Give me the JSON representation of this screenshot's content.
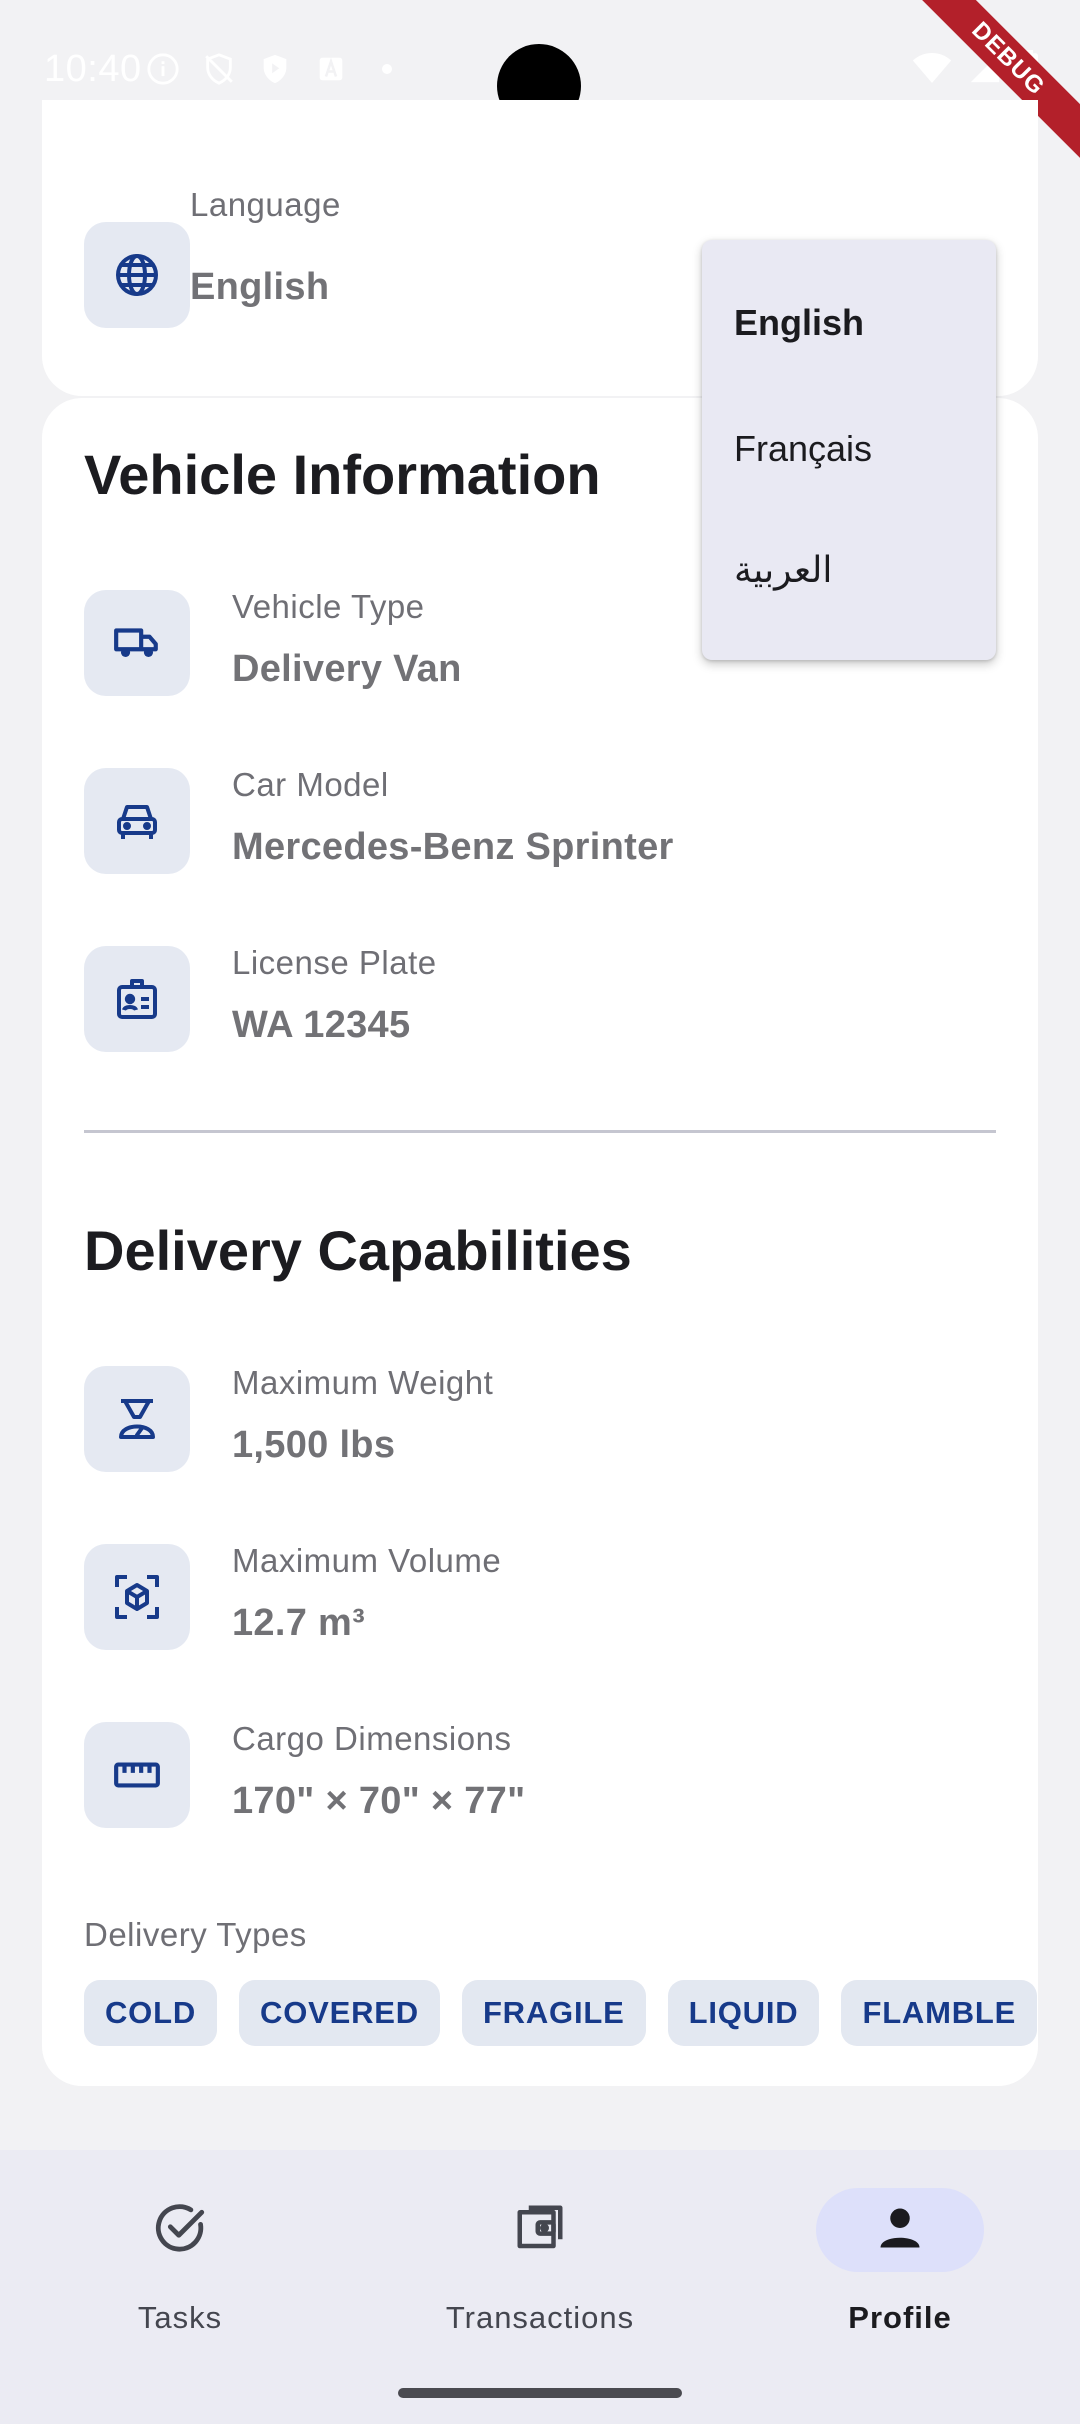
{
  "status_bar": {
    "time": "10:40",
    "debug_label": "DEBUG"
  },
  "language_card": {
    "label": "Language",
    "value": "English",
    "icon": "globe-icon"
  },
  "language_dropdown": {
    "options": [
      "English",
      "Français",
      "العربية"
    ],
    "selected": "English"
  },
  "vehicle_section": {
    "title": "Vehicle Information",
    "rows": [
      {
        "label": "Vehicle Type",
        "value": "Delivery Van",
        "icon": "truck-icon"
      },
      {
        "label": "Car Model",
        "value": "Mercedes-Benz Sprinter",
        "icon": "car-icon"
      },
      {
        "label": "License Plate",
        "value": "WA 12345",
        "icon": "id-card-icon"
      }
    ]
  },
  "capabilities_section": {
    "title": "Delivery Capabilities",
    "rows": [
      {
        "label": "Maximum Weight",
        "value": "1,500 lbs",
        "icon": "scale-icon"
      },
      {
        "label": "Maximum Volume",
        "value": "12.7 m³",
        "icon": "cube-scan-icon"
      },
      {
        "label": "Cargo Dimensions",
        "value": "170\" × 70\" × 77\"",
        "icon": "ruler-icon"
      }
    ],
    "types_label": "Delivery Types",
    "types": [
      "COLD",
      "COVERED",
      "FRAGILE",
      "LIQUID",
      "FLAMBLE"
    ]
  },
  "bottom_nav": {
    "items": [
      {
        "label": "Tasks",
        "icon": "check-circle-icon",
        "active": false
      },
      {
        "label": "Transactions",
        "icon": "wallet-icon",
        "active": false
      },
      {
        "label": "Profile",
        "icon": "person-icon",
        "active": true
      }
    ]
  },
  "colors": {
    "accent": "#173a8a",
    "icon_bg": "#e5e9f2",
    "nav_active_bg": "#dde0fa",
    "debug_ribbon": "#b3202a"
  }
}
